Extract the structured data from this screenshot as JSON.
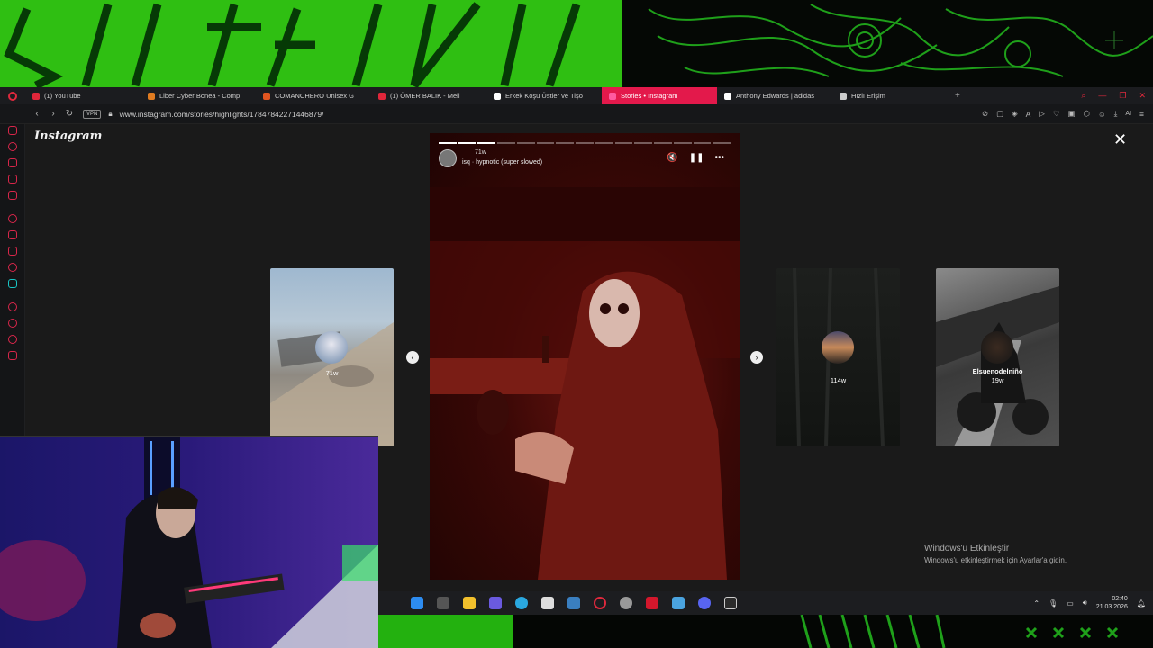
{
  "browser": {
    "tabs": [
      {
        "label": "(1) YouTube",
        "favicon_color": "#e0263a",
        "active": false
      },
      {
        "label": "Liber Cyber Bonea - Comp",
        "favicon_color": "#e07b20",
        "active": false
      },
      {
        "label": "COMANCHERO Unisex G",
        "favicon_color": "#e05520",
        "active": false
      },
      {
        "label": "(1) ÖMER BALIK - Meli",
        "favicon_color": "#e0263a",
        "active": false
      },
      {
        "label": "Erkek Koşu Üstler ve Tişö",
        "favicon_color": "#ffffff",
        "active": false
      },
      {
        "label": "Stories • Instagram",
        "favicon_color": "#ff5aa0",
        "active": true
      },
      {
        "label": "Anthony Edwards | adidas",
        "favicon_color": "#ffffff",
        "active": false
      },
      {
        "label": "Hızlı Erişim",
        "favicon_color": "#cccccc",
        "active": false
      }
    ],
    "new_tab": "+",
    "vpn_label": "VPN",
    "url": "www.instagram.com/stories/highlights/17847842271446879/",
    "tools_ai": "AI"
  },
  "instagram": {
    "logo": "Instagram",
    "close": "✕",
    "story": {
      "segments_total": 15,
      "segments_done": 3,
      "time_ago": "71w",
      "music": "isq · hypnotic (super slowed)",
      "mute_icon": "🔇",
      "pause_icon": "❚❚",
      "more_icon": "•••"
    },
    "prev_arrow": "‹",
    "next_arrow": "›",
    "thumbs": [
      {
        "label": "",
        "time": "71w"
      },
      {
        "label": "",
        "time": "114w"
      },
      {
        "label": "Elsuenodelniño",
        "time": "19w"
      }
    ]
  },
  "windows": {
    "activate_title": "Windows'u Etkinleştir",
    "activate_sub": "Windows'u etkinleştirmek için Ayarlar'a gidin.",
    "time": "02:40",
    "date": "21.03.2026"
  },
  "colors": {
    "accent": "#e3194b",
    "overlay_green": "#2fbf12"
  }
}
